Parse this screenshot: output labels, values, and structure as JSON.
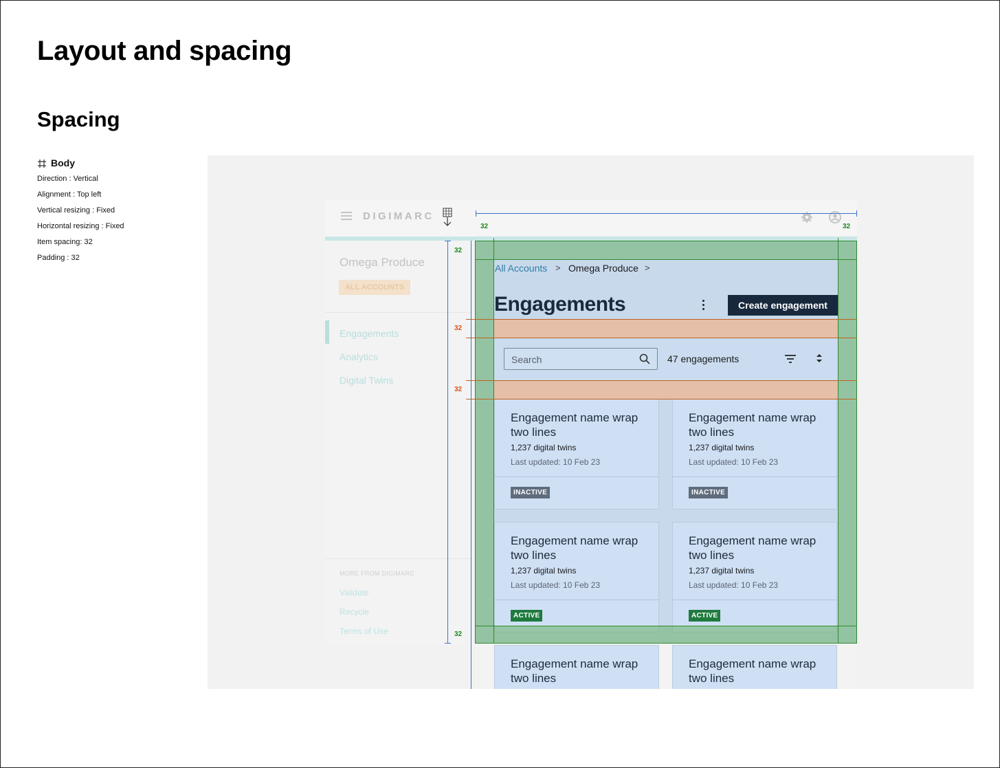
{
  "page": {
    "title": "Layout and spacing",
    "section": "Spacing"
  },
  "spec": {
    "frame_name": "Body",
    "lines": [
      "Direction : Vertical",
      "Alignment : Top left",
      "Vertical resizing : Fixed",
      "Horizontal resizing : Fixed",
      "Item spacing: 32",
      "Padding : 32"
    ]
  },
  "app": {
    "brand": "DIGIMARC",
    "sidebar": {
      "account": "Omega Produce",
      "badge": "ALL ACCOUNTS",
      "nav": [
        "Engagements",
        "Analytics",
        "Digital Twins"
      ],
      "more_heading": "MORE FROM DIGIMARC",
      "footer_links": [
        "Validate",
        "Recycle",
        "Terms of Use"
      ]
    },
    "breadcrumb": {
      "link": "All Accounts",
      "current": "Omega Produce",
      "separator": ">"
    },
    "heading": "Engagements",
    "create_button": "Create engagement",
    "search_placeholder": "Search",
    "count_text": "47 engagements",
    "cards": [
      {
        "name": "Engagement name wrap two lines",
        "twins": "1,237 digital twins",
        "updated": "Last updated: 10 Feb 23",
        "status": "INACTIVE"
      },
      {
        "name": "Engagement name wrap two lines",
        "twins": "1,237 digital twins",
        "updated": "Last updated: 10 Feb 23",
        "status": "INACTIVE"
      },
      {
        "name": "Engagement name wrap two lines",
        "twins": "1,237 digital twins",
        "updated": "Last updated: 10 Feb 23",
        "status": "ACTIVE"
      },
      {
        "name": "Engagement name wrap two lines",
        "twins": "1,237 digital twins",
        "updated": "Last updated: 10 Feb 23",
        "status": "ACTIVE"
      },
      {
        "name": "Engagement name wrap two lines"
      },
      {
        "name": "Engagement name wrap two lines"
      }
    ]
  },
  "annotations": {
    "padding_label": "32",
    "gap_label": "32"
  },
  "colors": {
    "padding": "#6eb46e",
    "gap": "#e6bfa8",
    "primary_button": "#18283d",
    "active": "#1f7a3e",
    "inactive": "#5f6c7c",
    "link": "#2f7ea6"
  }
}
